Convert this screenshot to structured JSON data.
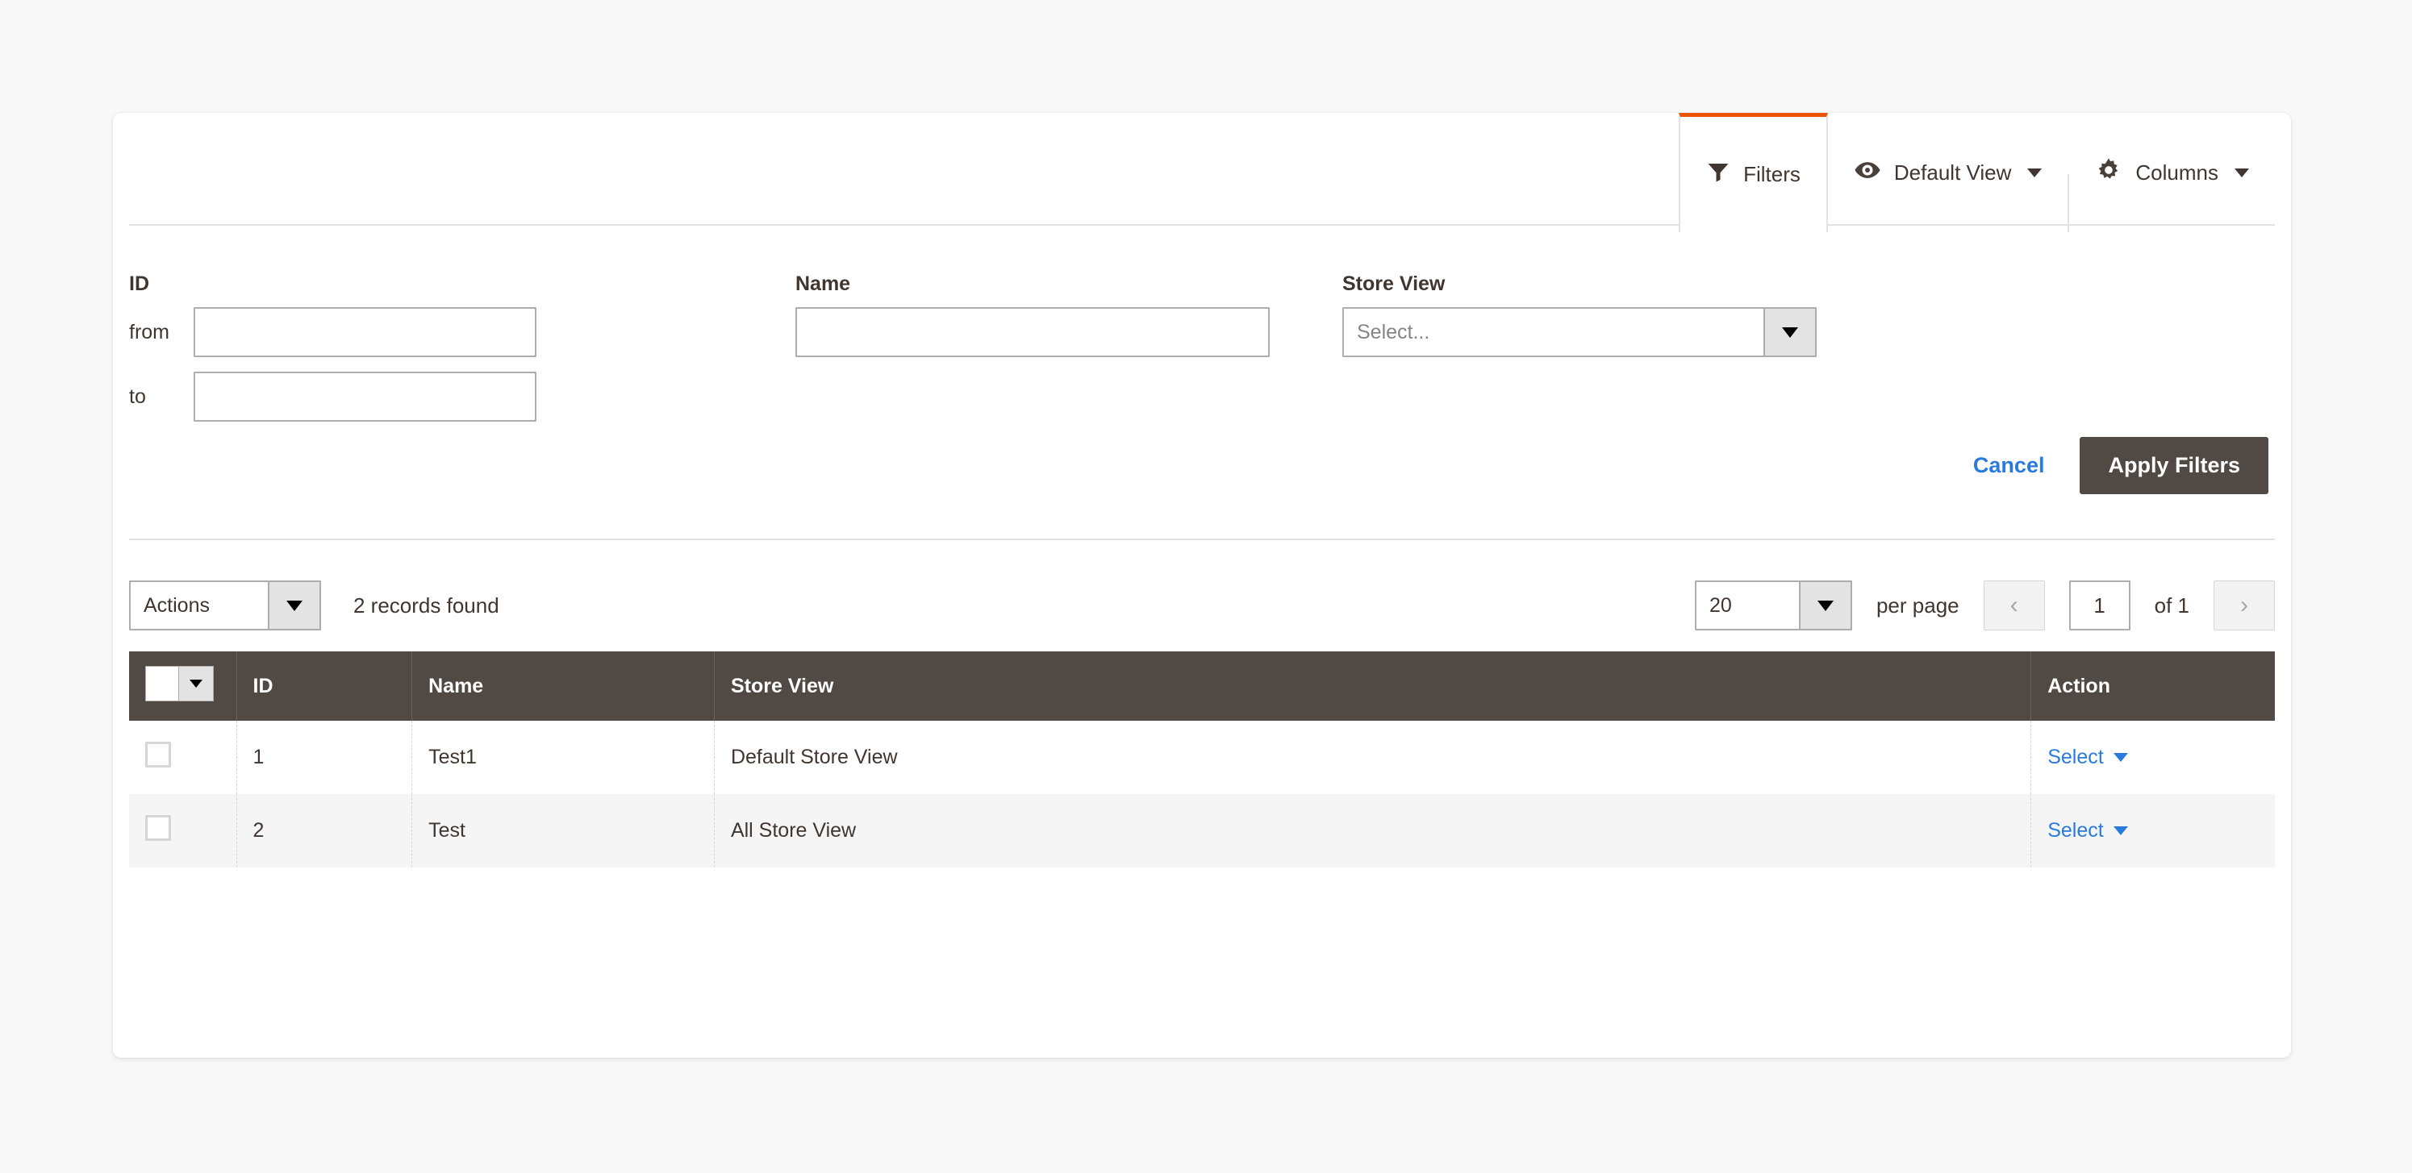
{
  "toolbar": {
    "tabs": [
      {
        "id": "filters",
        "label": "Filters",
        "icon": "funnel-icon",
        "active": true
      },
      {
        "id": "view",
        "label": "Default View",
        "icon": "eye-icon",
        "active": false
      },
      {
        "id": "columns",
        "label": "Columns",
        "icon": "gear-icon",
        "active": false
      }
    ]
  },
  "filters": {
    "id": {
      "label": "ID",
      "from_prefix": "from",
      "to_prefix": "to",
      "from_value": "",
      "to_value": "",
      "from_placeholder": "",
      "to_placeholder": ""
    },
    "name": {
      "label": "Name",
      "value": "",
      "placeholder": ""
    },
    "store_view": {
      "label": "Store View",
      "selected": "Select..."
    },
    "cancel_label": "Cancel",
    "apply_label": "Apply Filters"
  },
  "gridbar": {
    "actions_label": "Actions",
    "records_found": "2 records found",
    "per_page_value": "20",
    "per_page_label": "per page",
    "prev_icon": "chevron-left-icon",
    "next_icon": "chevron-right-icon",
    "current_page": "1",
    "of_label": "of 1"
  },
  "table": {
    "columns": [
      "ID",
      "Name",
      "Store View",
      "Action"
    ],
    "rows": [
      {
        "id": "1",
        "name": "Test1",
        "store_view": "Default Store View",
        "action": "Select"
      },
      {
        "id": "2",
        "name": "Test",
        "store_view": "All Store View",
        "action": "Select"
      }
    ]
  },
  "colors": {
    "accent": "#eb5202",
    "header": "#514943",
    "link": "#2a7ade",
    "text": "#41362f"
  }
}
